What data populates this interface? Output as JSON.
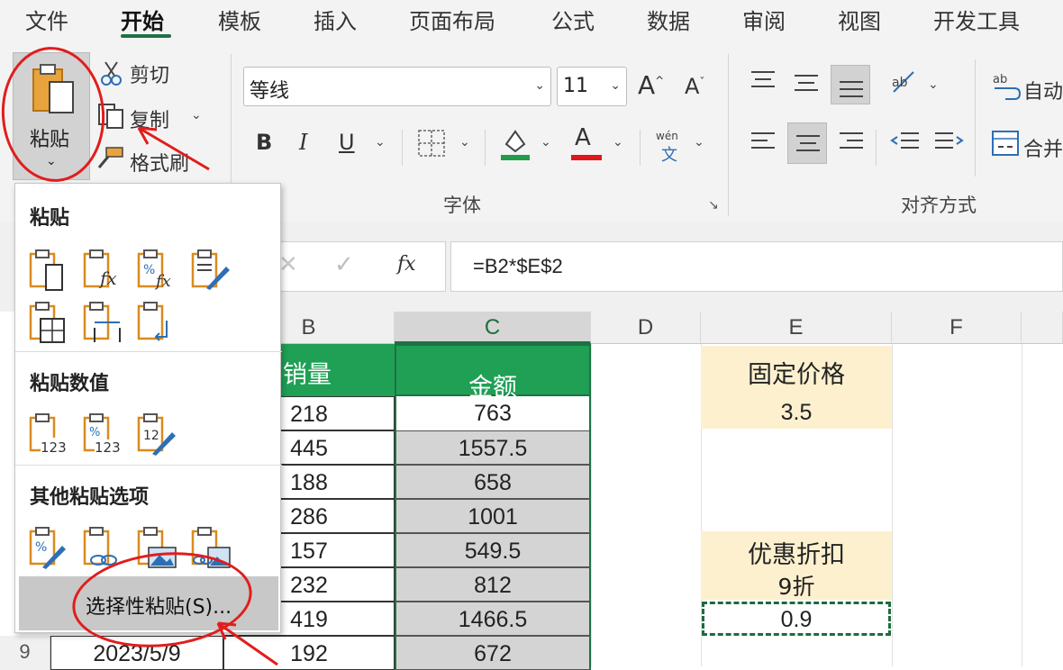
{
  "menu": {
    "tabs": [
      "文件",
      "开始",
      "模板",
      "插入",
      "页面布局",
      "公式",
      "数据",
      "审阅",
      "视图",
      "开发工具"
    ],
    "active": "开始"
  },
  "clipboard": {
    "paste": "粘贴",
    "cut": "剪切",
    "copy": "复制",
    "format_painter": "格式刷"
  },
  "font": {
    "name": "等线",
    "size": "11",
    "group_label": "字体",
    "phonetic_top": "wén",
    "phonetic_bottom": "文"
  },
  "align": {
    "group_label": "对齐方式",
    "wrap": "自动",
    "merge": "合并"
  },
  "formula": {
    "fx": "fx",
    "content": "=B2*$E$2"
  },
  "columns": [
    "B",
    "C",
    "D",
    "E",
    "F"
  ],
  "table": {
    "header_b": "销量",
    "header_c": "金额",
    "rows": [
      {
        "b": "218",
        "c": "763"
      },
      {
        "b": "445",
        "c": "1557.5"
      },
      {
        "b": "188",
        "c": "658"
      },
      {
        "b": "286",
        "c": "1001"
      },
      {
        "b": "157",
        "c": "549.5"
      },
      {
        "b": "232",
        "c": "812"
      },
      {
        "b": "419",
        "c": "1466.5"
      },
      {
        "b": "192",
        "c": "672"
      }
    ],
    "last_row_num": "9",
    "last_row_date": "2023/5/9"
  },
  "side": {
    "fixed_price_label": "固定价格",
    "fixed_price_value": "3.5",
    "discount_label": "优惠折扣",
    "discount_sub": "9折",
    "discount_value": "0.9"
  },
  "paste_menu": {
    "section1": "粘贴",
    "section2": "粘贴数值",
    "section3": "其他粘贴选项",
    "special": "选择性粘贴(S)..."
  },
  "colors": {
    "header_green": "#1fa055",
    "accent_green": "#1e7145",
    "cream": "#fdf0cf",
    "annotation_red": "#e11d1d"
  }
}
